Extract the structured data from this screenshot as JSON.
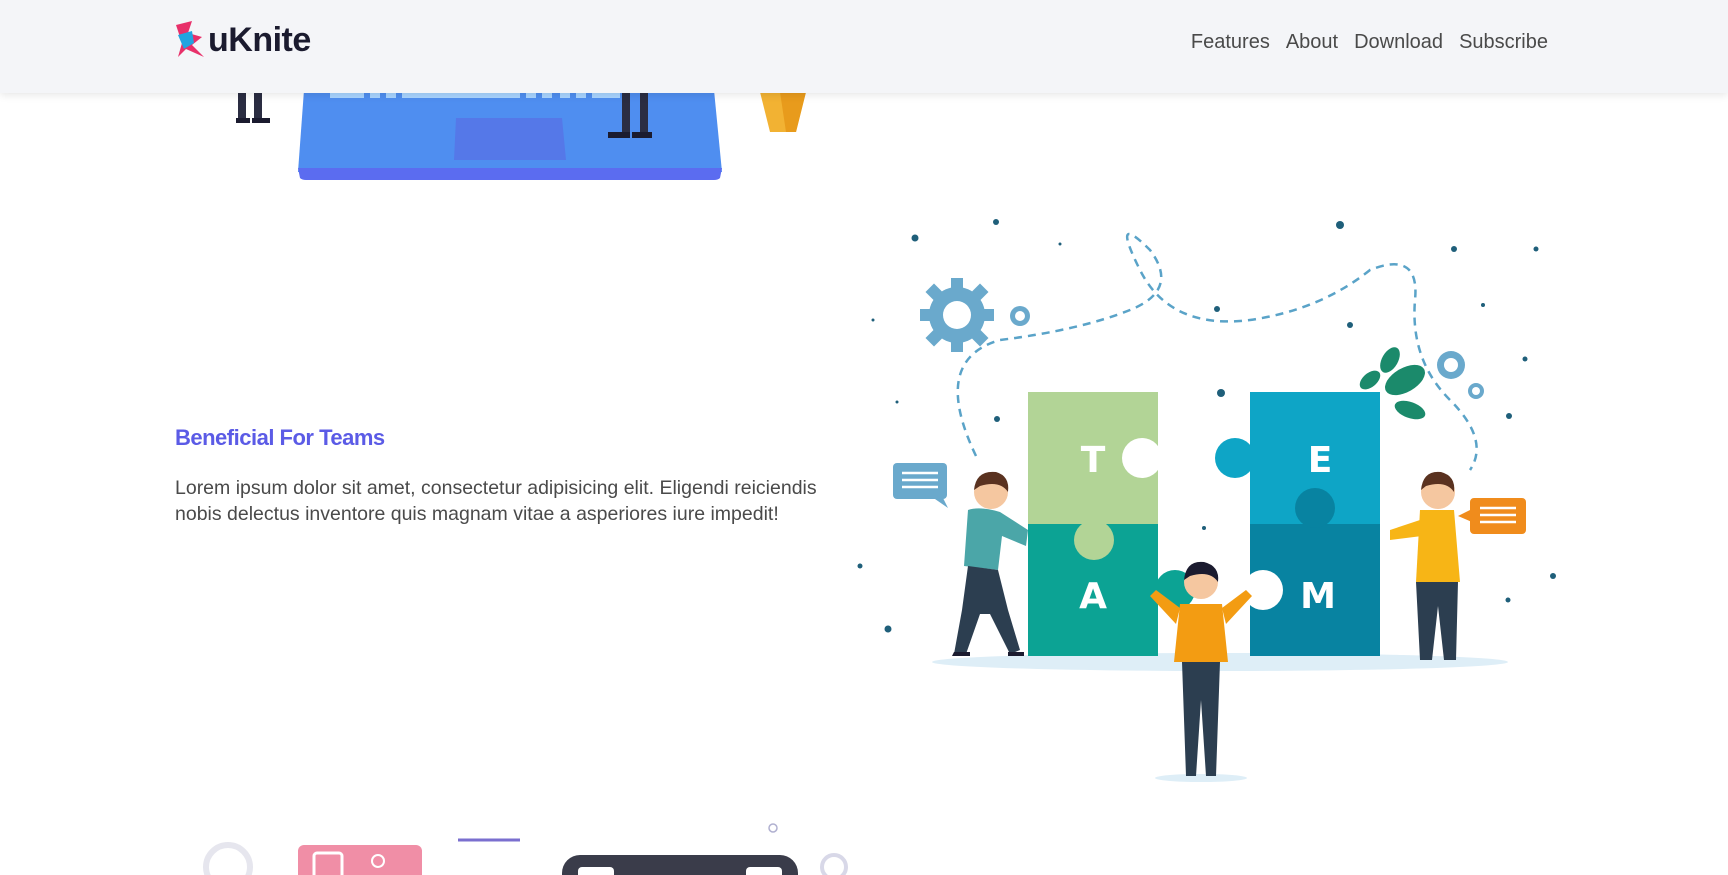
{
  "brand": {
    "name": "uKnite"
  },
  "nav": {
    "links": [
      {
        "label": "Features"
      },
      {
        "label": "About"
      },
      {
        "label": "Download"
      },
      {
        "label": "Subscribe"
      }
    ]
  },
  "feature": {
    "title": "Beneficial For Teams",
    "description": "Lorem ipsum dolor sit amet, consectetur adipisicing elit. Eligendi reiciendis nobis delectus inventore quis magnam vitae a asperiores iure impedit!"
  },
  "illustration": {
    "puzzle_letters": [
      "T",
      "E",
      "A",
      "M"
    ]
  },
  "colors": {
    "accent": "#5b5be6",
    "navbar_bg": "#f4f5f8",
    "brand_pink": "#e8306a",
    "brand_blue": "#22a4e0"
  }
}
